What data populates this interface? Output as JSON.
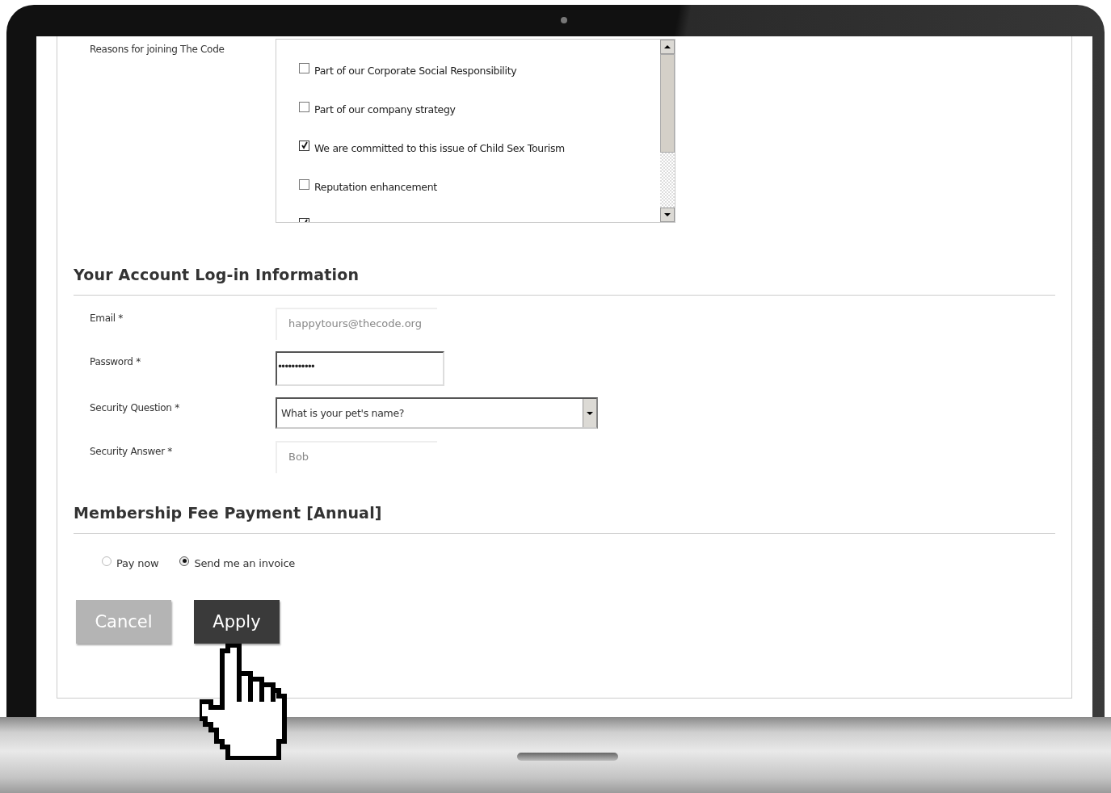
{
  "reasons": {
    "label": "Reasons for joining The Code",
    "options": [
      {
        "label": "Part of our Corporate Social Responsibility",
        "checked": false
      },
      {
        "label": "Part of our company strategy",
        "checked": false
      },
      {
        "label": "We are committed to this issue of Child Sex Tourism",
        "checked": true
      },
      {
        "label": "Reputation enhancement",
        "checked": false
      },
      {
        "checked": true
      }
    ]
  },
  "account": {
    "heading": "Your Account Log-in Information",
    "fields": [
      {
        "kind": "text",
        "label": "Email *",
        "value": "happytours@thecode.org"
      },
      {
        "kind": "password",
        "label": "Password *",
        "value": "•••••••••••"
      },
      {
        "kind": "select",
        "label": "Security Question *",
        "value": "What is your pet's name?"
      },
      {
        "kind": "text",
        "label": "Security Answer *",
        "value": "Bob"
      }
    ]
  },
  "payment": {
    "heading": "Membership Fee Payment [Annual]",
    "options": [
      {
        "label": "Pay now",
        "selected": false
      },
      {
        "label": "Send me an invoice",
        "selected": true
      }
    ]
  },
  "buttons": [
    {
      "label": "Cancel",
      "disabled": true
    },
    {
      "label": "Apply",
      "disabled": false
    }
  ]
}
